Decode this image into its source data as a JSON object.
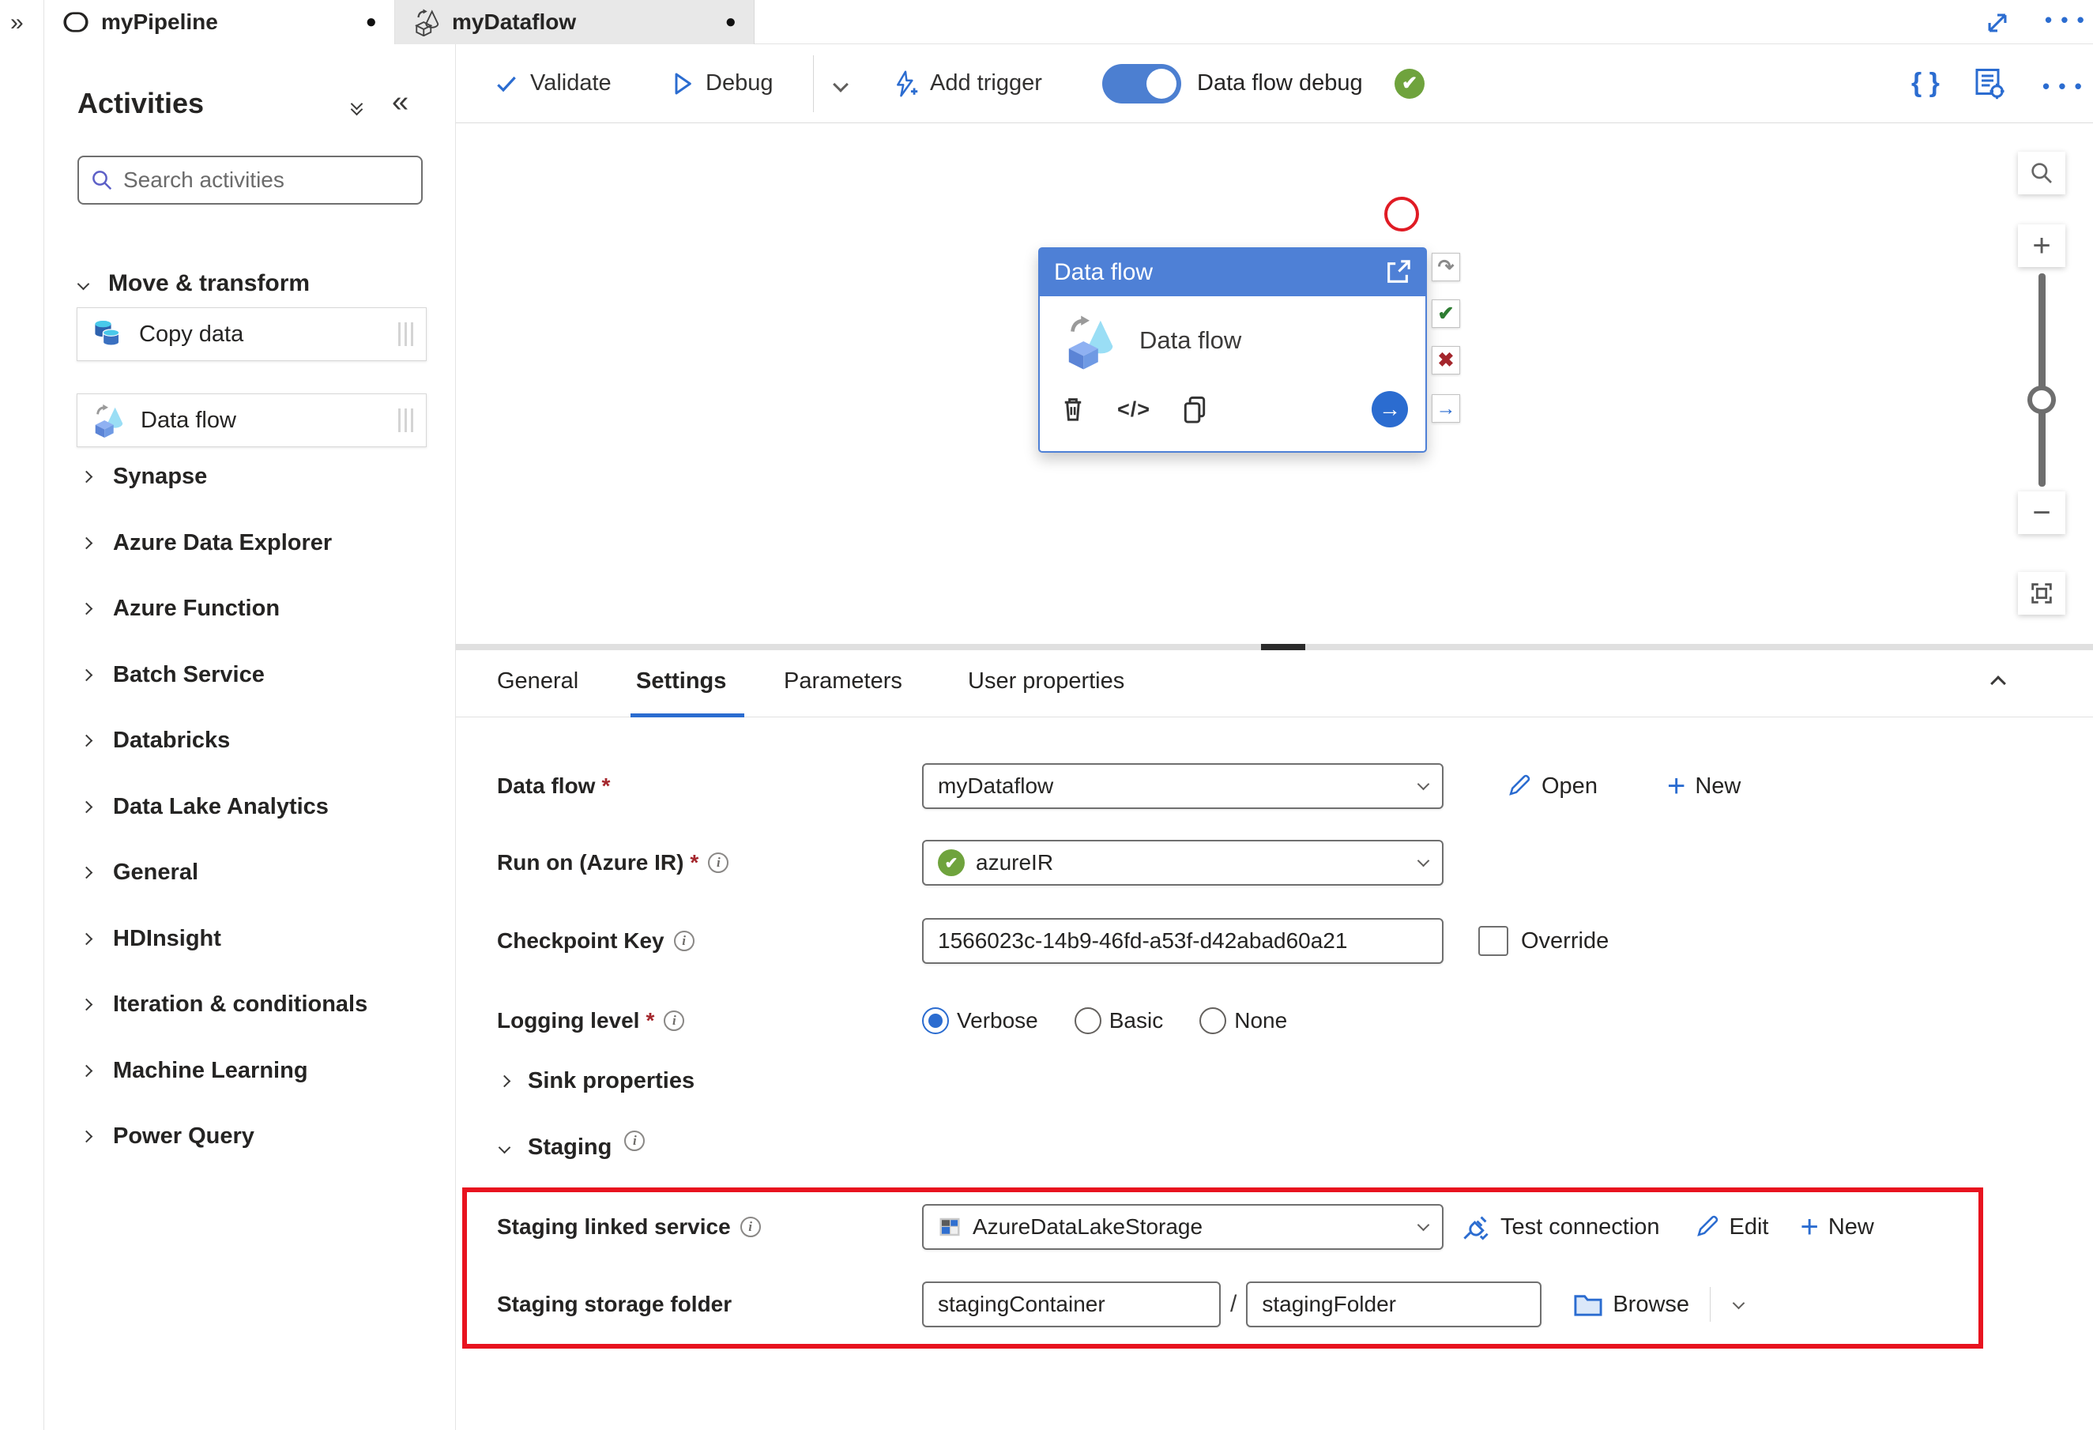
{
  "window": {
    "rail_icon": "»"
  },
  "tabs": [
    {
      "label": "myPipeline",
      "dirty": "●"
    },
    {
      "label": "myDataflow",
      "dirty": "●"
    }
  ],
  "toolbar": {
    "validate": "Validate",
    "debug": "Debug",
    "add_trigger": "Add trigger",
    "dataflow_debug_label": "Data flow debug"
  },
  "sidebar": {
    "title": "Activities",
    "search_placeholder": "Search activities",
    "group": "Move & transform",
    "activities": [
      "Copy data",
      "Data flow"
    ],
    "categories": [
      "Synapse",
      "Azure Data Explorer",
      "Azure Function",
      "Batch Service",
      "Databricks",
      "Data Lake Analytics",
      "General",
      "HDInsight",
      "Iteration & conditionals",
      "Machine Learning",
      "Power Query"
    ]
  },
  "canvas": {
    "node_title": "Data flow",
    "node_label": "Data flow"
  },
  "panel": {
    "tabs": [
      "General",
      "Settings",
      "Parameters",
      "User properties"
    ],
    "form": {
      "dataflow_label": "Data flow",
      "dataflow_value": "myDataflow",
      "open_label": "Open",
      "new_label": "New",
      "runon_label": "Run on (Azure IR)",
      "runon_value": "azureIR",
      "checkpoint_label": "Checkpoint Key",
      "checkpoint_value": "1566023c-14b9-46fd-a53f-d42abad60a21",
      "override_label": "Override",
      "logging_label": "Logging level",
      "logging_options": [
        "Verbose",
        "Basic",
        "None"
      ],
      "sink_section": "Sink properties",
      "staging_section": "Staging",
      "staging_ls_label": "Staging linked service",
      "staging_ls_value": "AzureDataLakeStorage",
      "test_connection_label": "Test connection",
      "edit_label": "Edit",
      "staging_new_label": "New",
      "storage_folder_label": "Staging storage folder",
      "container_value": "stagingContainer",
      "path_separator": "/",
      "folder_value": "stagingFolder",
      "browse_label": "Browse"
    }
  },
  "icons": {
    "redo": "↷",
    "accept": "✔",
    "reject": "✖",
    "arrow_right": "→",
    "ellipsis": "• • •",
    "braces": "{ }",
    "plus": "+",
    "minus": "−",
    "code": "</>",
    "double_left": "«"
  },
  "colors": {
    "accent_blue": "#2b6cd0",
    "node_header_blue": "#4e80d6",
    "toggle_on_blue": "#4c7fd1",
    "success_green": "#6fa33d",
    "error_red": "#a4262c",
    "highlight_red": "#e8131f"
  }
}
